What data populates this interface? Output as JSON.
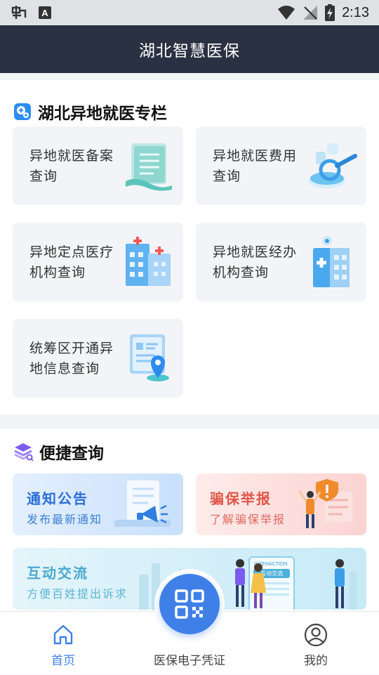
{
  "status_bar": {
    "time": "2:13",
    "icons": [
      "app-bug-icon",
      "font-a-icon",
      "wifi-icon",
      "no-signal-icon",
      "battery-charging-icon"
    ]
  },
  "app_bar": {
    "title": "湖北智慧医保"
  },
  "remote_section": {
    "title": "湖北异地就医专栏",
    "tiles": [
      {
        "line1": "异地就医备案",
        "line2": "查询",
        "icon": "document-record-icon"
      },
      {
        "line1": "异地就医费用",
        "line2": "查询",
        "icon": "search-magnifier-icon"
      },
      {
        "line1": "异地定点医疗",
        "line2": "机构查询",
        "icon": "hospital-buildings-icon"
      },
      {
        "line1": "异地就医经办",
        "line2": "机构查询",
        "icon": "medical-agency-icon"
      },
      {
        "line1": "统筹区开通异",
        "line2": "地信息查询",
        "icon": "location-card-icon"
      }
    ]
  },
  "quick_section": {
    "title": "便捷查询",
    "banners": [
      {
        "title": "通知公告",
        "subtitle": "发布最新通知",
        "icon": "megaphone-icon"
      },
      {
        "title": "骗保举报",
        "subtitle": "了解骗保举报",
        "icon": "report-warning-icon"
      },
      {
        "title": "互动交流",
        "subtitle": "方便百姓提出诉求",
        "illustration_text": "INTERACTION",
        "illustration_subtext": "互动交流",
        "icon": "interaction-people-icon"
      }
    ]
  },
  "tab_bar": {
    "items": [
      {
        "label": "首页",
        "icon": "home-icon",
        "active": true
      },
      {
        "label": "医保电子凭证",
        "icon": "qr-code-icon",
        "active": false
      },
      {
        "label": "我的",
        "icon": "user-icon",
        "active": false
      }
    ]
  },
  "colors": {
    "app_bar": "#293142",
    "accent": "#3f7fe8",
    "notice_title": "#2a6fd6",
    "report_title": "#e0564a"
  }
}
